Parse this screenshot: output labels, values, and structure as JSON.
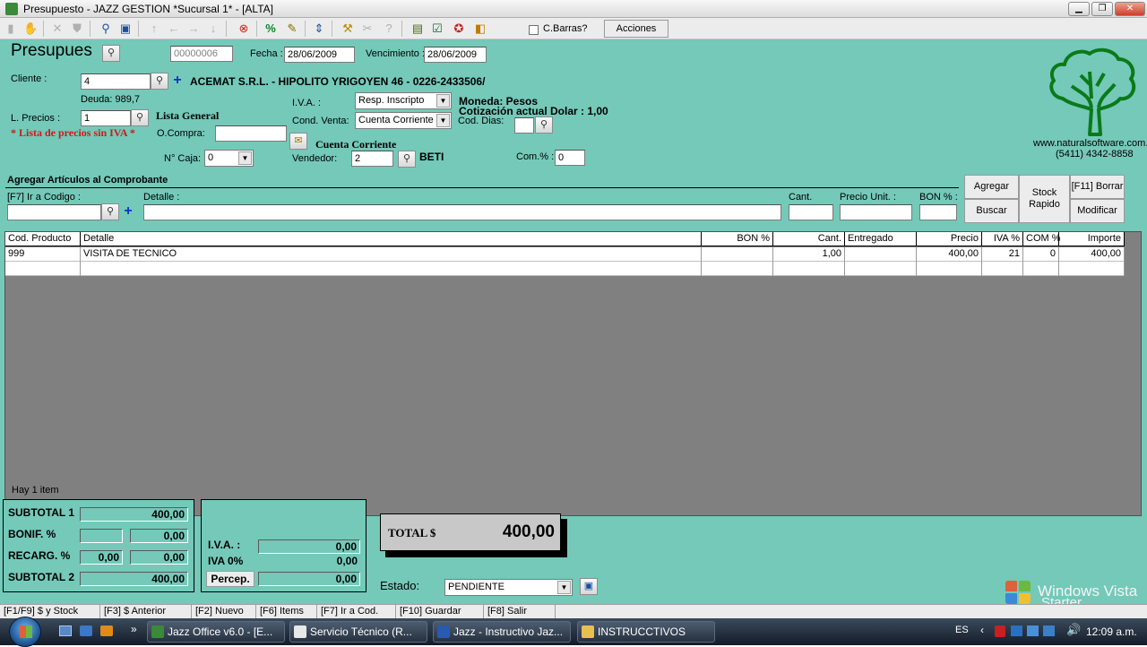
{
  "window": {
    "title": "Presupuesto - JAZZ GESTION *Sucursal 1* - [ALTA]"
  },
  "toolbar": {
    "cbarras_label": "C.Barras?",
    "acciones_label": "Acciones"
  },
  "header": {
    "title": "Presupues",
    "number": "00000006",
    "fecha_label": "Fecha :",
    "fecha": "28/06/2009",
    "vencimiento_label": "Vencimiento :",
    "vencimiento": "28/06/2009"
  },
  "client": {
    "label": "Cliente :",
    "code": "4",
    "name": "ACEMAT S.R.L. - HIPOLITO YRIGOYEN 46 - 0226-2433506/",
    "deuda": "Deuda: 989,7"
  },
  "precios": {
    "label": "L. Precios :",
    "value": "1",
    "list_name": "Lista General",
    "warning": "* Lista de precios sin IVA *"
  },
  "ocompra": {
    "label": "O.Compra:",
    "value": ""
  },
  "caja": {
    "label": "N° Caja:",
    "value": "0"
  },
  "iva": {
    "label": "I.V.A. :",
    "value": "Resp. Inscripto"
  },
  "cond_venta": {
    "label": "Cond. Venta:",
    "value": "Cuenta Corriente",
    "caption": "Cuenta Corriente"
  },
  "vendedor": {
    "label": "Vendedor:",
    "value": "2",
    "name": "BETI"
  },
  "moneda": {
    "moneda": "Moneda: Pesos",
    "cotizacion": "Cotización actual Dolar : 1,00"
  },
  "cod_dias": {
    "label": "Cod. Dias:",
    "value": ""
  },
  "com": {
    "label": "Com.% :",
    "value": "0"
  },
  "brand": {
    "url": "www.naturalsoftware.com.ar",
    "phone": "(5411) 4342-8858"
  },
  "add_items": {
    "section_title": "Agregar Artículos al Comprobante",
    "code_label": "[F7] Ir a Codigo :",
    "detalle_label": "Detalle :",
    "cant_label": "Cant.",
    "precio_label": "Precio Unit. :",
    "bon_label": "BON % :",
    "agregar": "Agregar",
    "buscar": "Buscar",
    "stock": "Stock Rapido",
    "borrar": "[F11] Borrar",
    "modificar": "Modificar"
  },
  "table": {
    "columns": [
      "Cod. Producto",
      "Detalle",
      "BON %",
      "Cant.",
      "Entregado",
      "Precio",
      "IVA %",
      "COM %",
      "Importe"
    ],
    "rows": [
      [
        "999",
        "VISITA DE TECNICO",
        "",
        "1,00",
        "",
        "400,00",
        "21",
        "0",
        "400,00"
      ]
    ]
  },
  "items_count": "Hay 1 item",
  "totals": {
    "subtotal1_label": "SUBTOTAL 1",
    "subtotal1": "400,00",
    "bonif_label": "BONIF. %",
    "bonif_pct": "",
    "bonif_amount": "0,00",
    "recarg_label": "RECARG. %",
    "recarg_pct": "0,00",
    "recarg_amount": "0,00",
    "subtotal2_label": "SUBTOTAL 2",
    "subtotal2": "400,00",
    "iva_label": "I.V.A. :",
    "iva": "0,00",
    "iva0_label": "IVA 0%",
    "iva0": "0,00",
    "percep_label": "Percep.",
    "percep": "0,00",
    "total_label": "TOTAL $",
    "total": "400,00",
    "estado_label": "Estado:",
    "estado": "PENDIENTE"
  },
  "statusbar": [
    "[F1/F9] $ y Stock",
    "[F3] $ Anterior",
    "[F2] Nuevo",
    "[F6] Items",
    "[F7] Ir a Cod.",
    "[F10] Guardar",
    "[F8] Salir"
  ],
  "vista": {
    "line1": "Windows Vista",
    "line2": "Starter"
  },
  "taskbar": {
    "tasks": [
      "Jazz Office v6.0 - [E...",
      "Servicio Técnico (R...",
      "Jazz - Instructivo Jaz...",
      "INSTRUCCTIVOS"
    ],
    "lang": "ES",
    "time": "12:09 a.m."
  }
}
